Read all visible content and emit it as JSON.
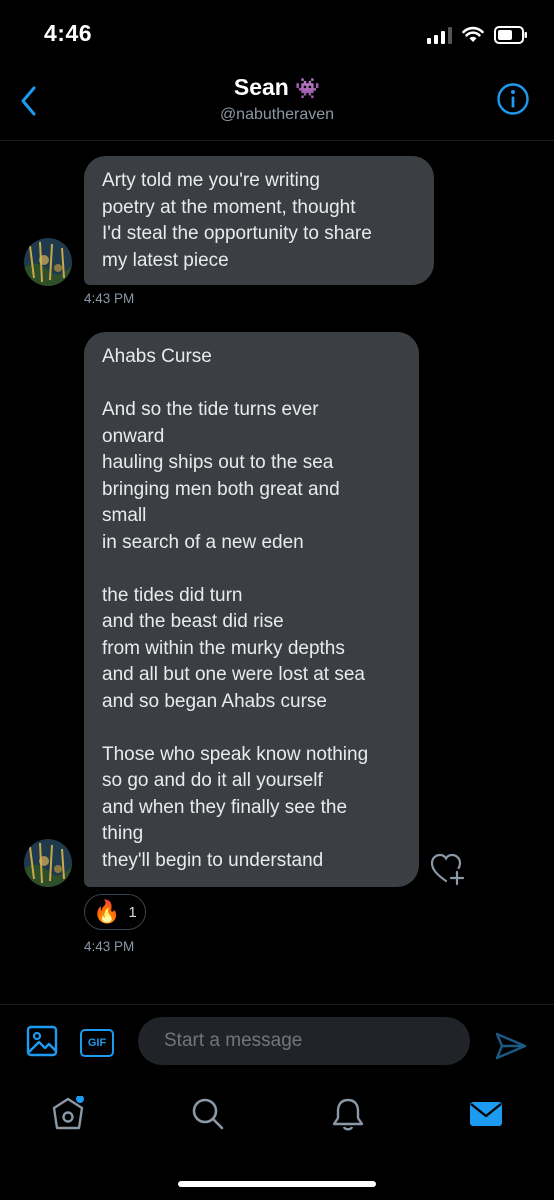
{
  "status_bar": {
    "time": "4:46"
  },
  "header": {
    "name": "Sean",
    "emoji": "👾",
    "handle": "@nabutheraven"
  },
  "messages": [
    {
      "lines": [
        "Arty told me you're writing",
        "poetry at the moment, thought",
        "I'd steal the opportunity to share",
        "my latest piece"
      ],
      "time": "4:43 PM"
    },
    {
      "lines": [
        "Ahabs Curse",
        "",
        "And so the tide turns ever",
        "onward",
        "hauling ships out to the sea",
        "bringing men both great and",
        "small",
        "in search of a new eden",
        "",
        "the tides did turn",
        "and the beast did rise",
        "from within the murky depths",
        "and all but one were lost at sea",
        "and so began Ahabs curse",
        "",
        "Those who speak know nothing",
        "so go and do it all yourself",
        "and when they finally see the",
        "thing",
        "they'll begin to understand"
      ],
      "time": "4:43 PM",
      "reaction": {
        "emoji": "🔥",
        "count": "1"
      }
    }
  ],
  "compose": {
    "placeholder": "Start a message",
    "gif_label": "GIF"
  },
  "icons": {
    "back": "chevron-left-icon",
    "info": "info-icon",
    "media": "image-icon",
    "send": "send-icon",
    "home": "home-icon",
    "search": "search-icon",
    "notifications": "bell-icon",
    "messages": "envelope-icon"
  },
  "colors": {
    "accent": "#1d9bf0",
    "bubble": "#3b3f43",
    "background": "#000000",
    "muted": "#8b98a5"
  }
}
